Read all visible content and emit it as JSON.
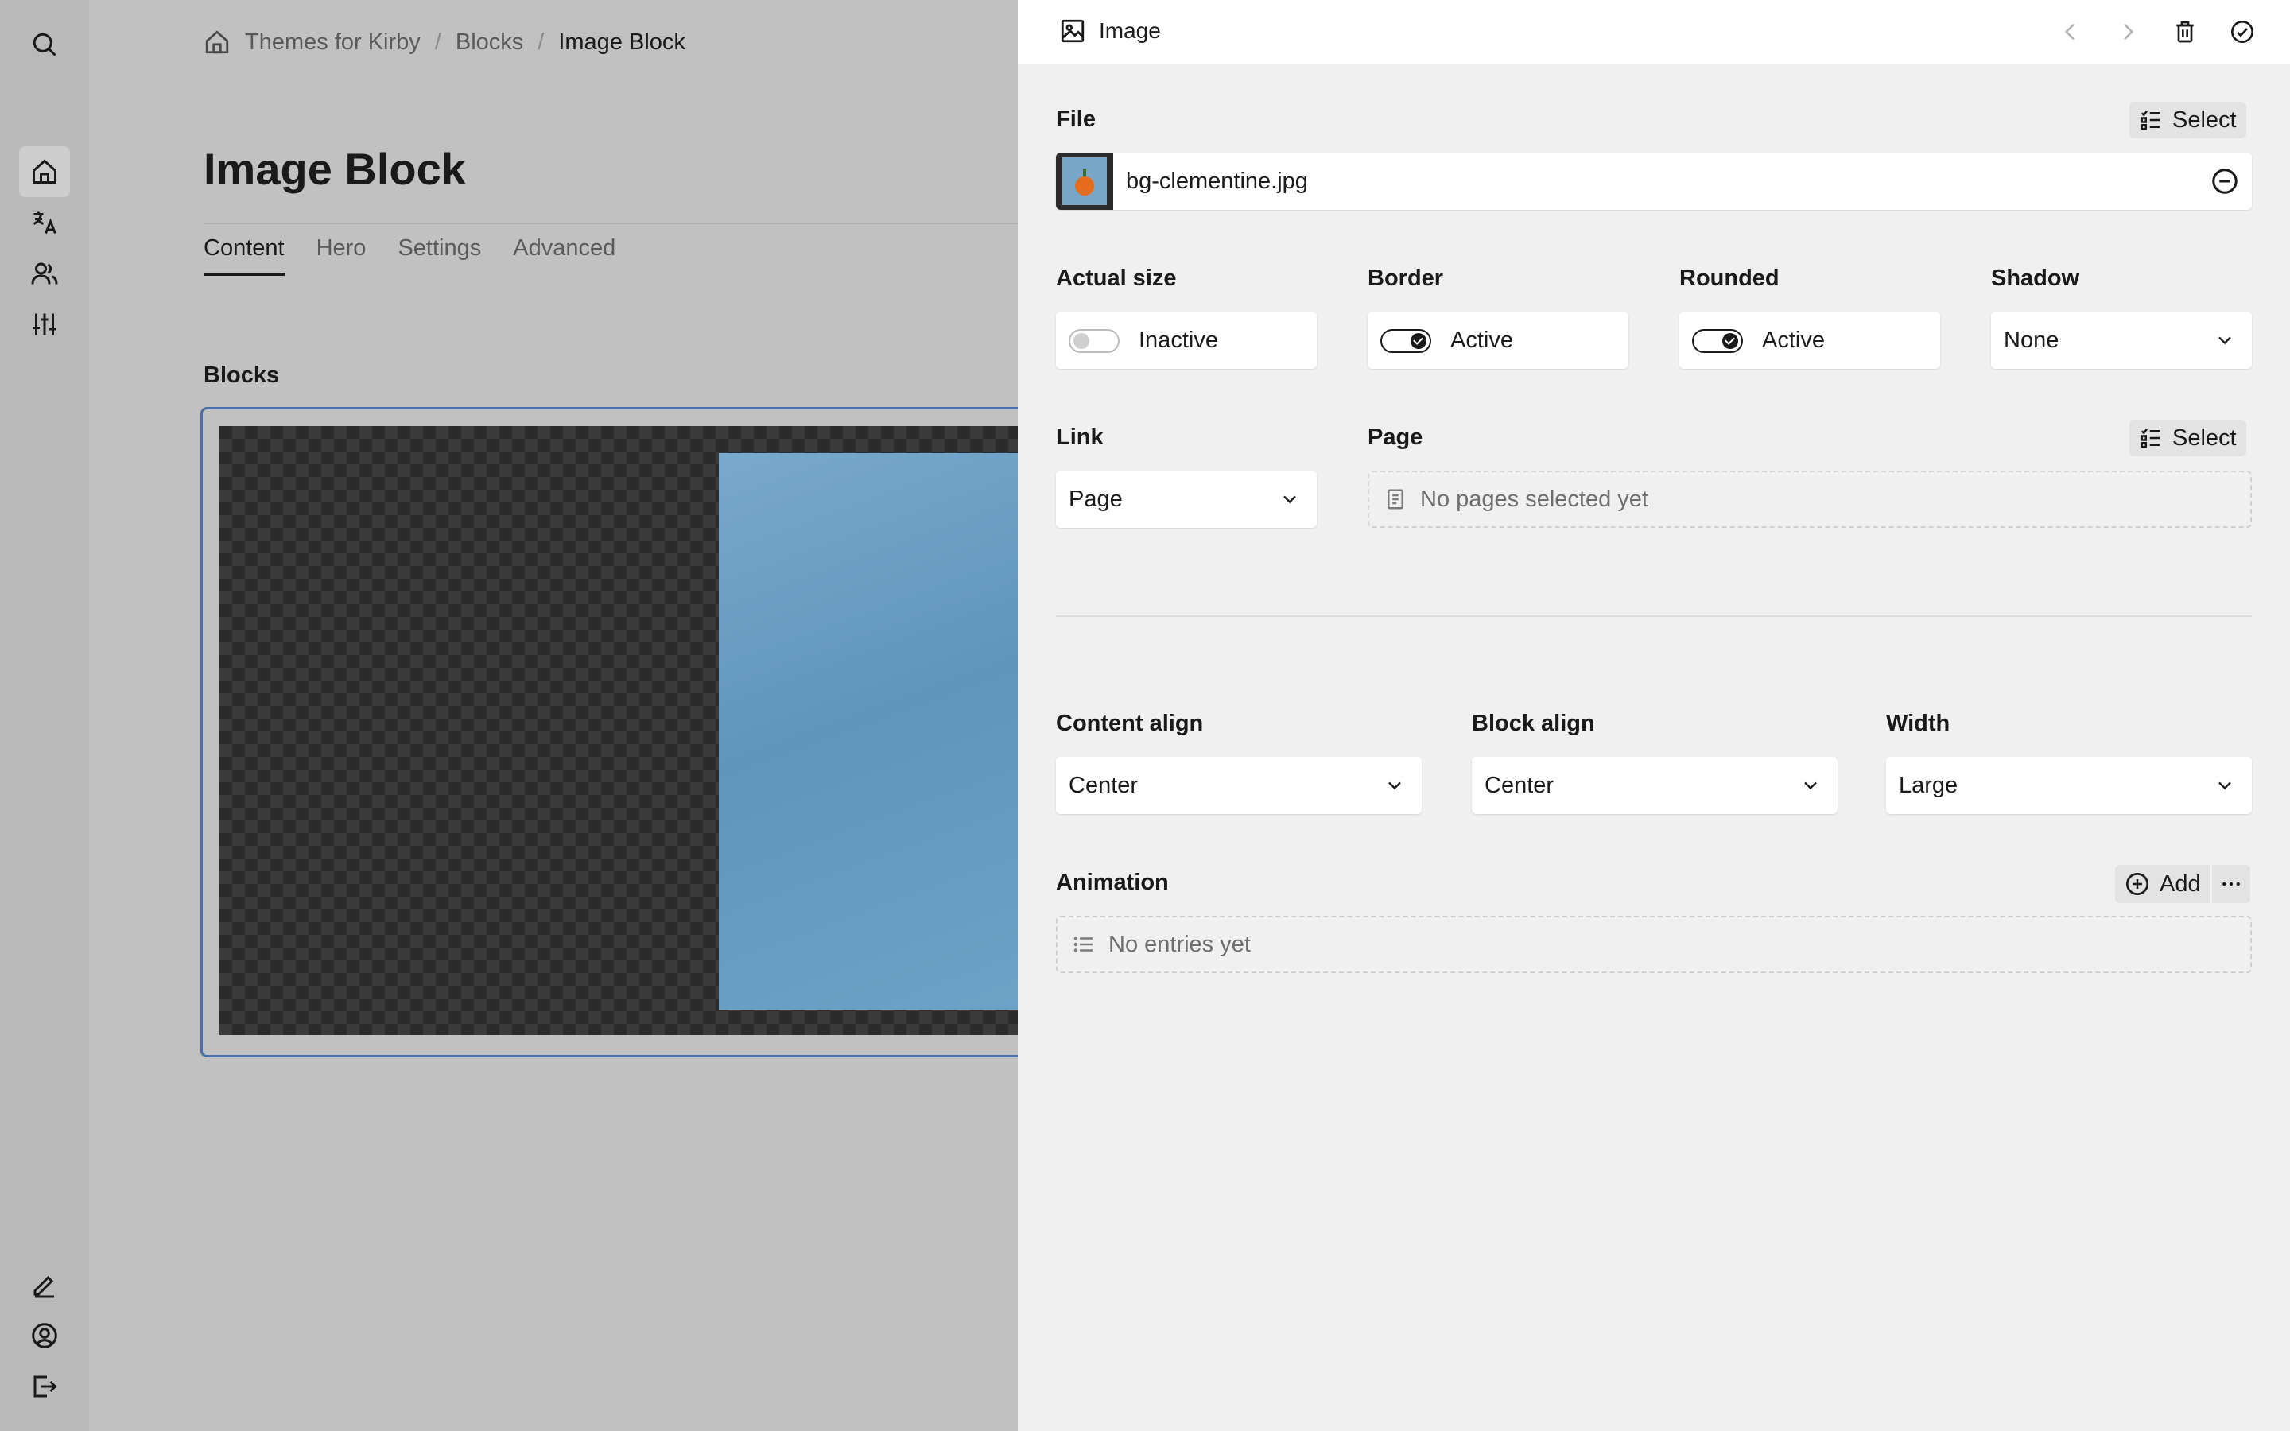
{
  "sidebar": {
    "top_icons": [
      "search-icon"
    ],
    "nav_icons": [
      "home-icon",
      "languages-icon",
      "users-icon",
      "settings-sliders-icon"
    ],
    "bottom_icons": [
      "pen-icon",
      "account-icon",
      "logout-icon"
    ]
  },
  "breadcrumb": {
    "home_icon": "home-icon",
    "items": [
      "Themes for Kirby",
      "Blocks",
      "Image Block"
    ],
    "separator": "/"
  },
  "page": {
    "title": "Image Block",
    "tabs": [
      "Content",
      "Hero",
      "Settings",
      "Advanced"
    ],
    "active_tab": "Content",
    "blocks_label": "Blocks"
  },
  "drawer": {
    "title": "Image",
    "title_icon": "image-icon",
    "header_icons": [
      "chevron-left-icon",
      "chevron-right-icon",
      "trash-icon",
      "check-circle-icon"
    ],
    "file": {
      "label": "File",
      "select_label": "Select",
      "filename": "bg-clementine.jpg"
    },
    "toggles": [
      {
        "label": "Actual size",
        "state": "Inactive",
        "on": false
      },
      {
        "label": "Border",
        "state": "Active",
        "on": true
      },
      {
        "label": "Rounded",
        "state": "Active",
        "on": true
      }
    ],
    "shadow": {
      "label": "Shadow",
      "value": "None"
    },
    "link": {
      "label": "Link",
      "value": "Page"
    },
    "page_field": {
      "label": "Page",
      "select_label": "Select",
      "empty": "No pages selected yet"
    },
    "content_align": {
      "label": "Content align",
      "value": "Center"
    },
    "block_align": {
      "label": "Block align",
      "value": "Center"
    },
    "width": {
      "label": "Width",
      "value": "Large"
    },
    "animation": {
      "label": "Animation",
      "add_label": "Add",
      "empty": "No entries yet"
    }
  }
}
